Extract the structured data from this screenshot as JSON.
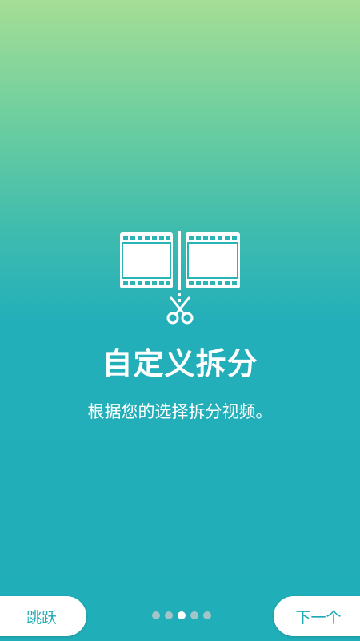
{
  "onboarding": {
    "title": "自定义拆分",
    "description": "根据您的选择拆分视频。",
    "illustration_icon": "film-split-scissors-icon",
    "current_page": 3,
    "total_pages": 5
  },
  "footer": {
    "skip_label": "跳跃",
    "next_label": "下一个"
  },
  "colors": {
    "gradient_top": "#a6de95",
    "gradient_bottom": "#20aeb9",
    "button_text": "#1ea9b5",
    "dot_inactive": "#b9c9cb",
    "dot_active": "#ffffff"
  }
}
